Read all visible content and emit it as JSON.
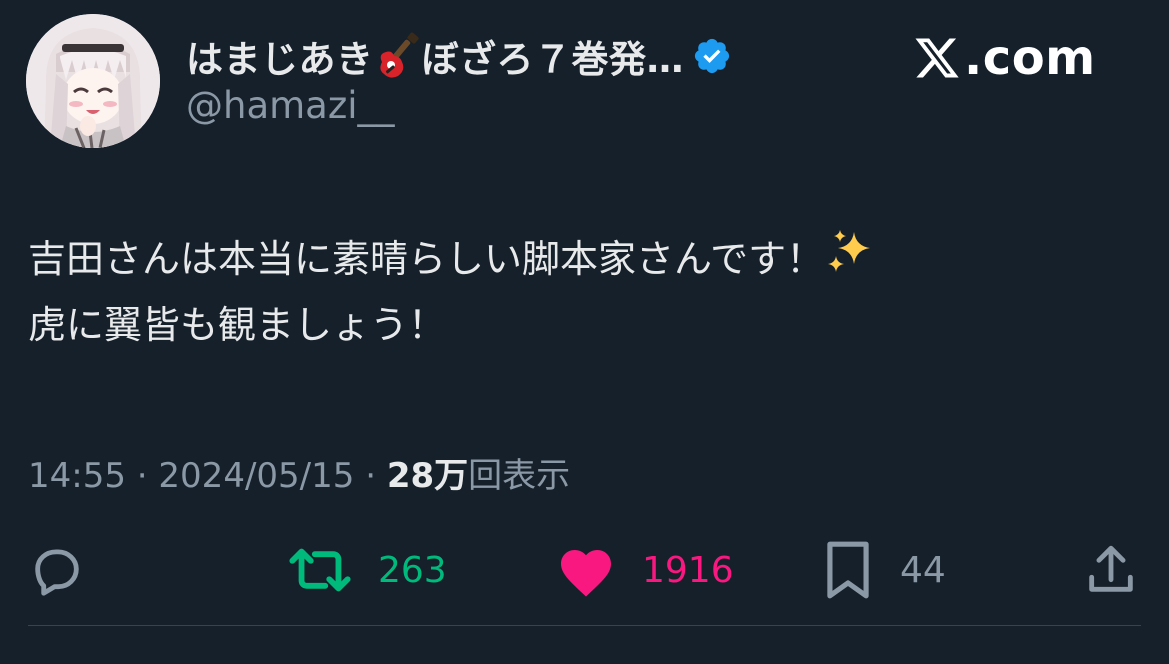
{
  "author": {
    "display_name": "はまじあき",
    "display_name_suffix": "ぼざろ７巻発…",
    "handle": "@hamazi__",
    "verified": true
  },
  "site": {
    "domain": ".com"
  },
  "tweet": {
    "line1": "吉田さんは本当に素晴らしい脚本家さんです！",
    "line2": "虎に翼皆も観ましょう！",
    "time": "14:55",
    "date": "2024/05/15",
    "separator": " · ",
    "views_count": "28万",
    "views_label": "回表示"
  },
  "actions": {
    "reply_count": "",
    "retweet_count": "263",
    "like_count": "1916",
    "bookmark_count": "44"
  },
  "colors": {
    "background": "#15202b",
    "text": "#e7e9ea",
    "secondary": "#8b98a5",
    "retweet": "#00ba7c",
    "like": "#f91880",
    "verified": "#1d9bf0"
  },
  "icons": [
    "guitar-icon",
    "verified-icon",
    "x-logo-icon",
    "sparkles-icon",
    "reply-icon",
    "retweet-icon",
    "heart-icon",
    "bookmark-icon",
    "share-icon"
  ]
}
